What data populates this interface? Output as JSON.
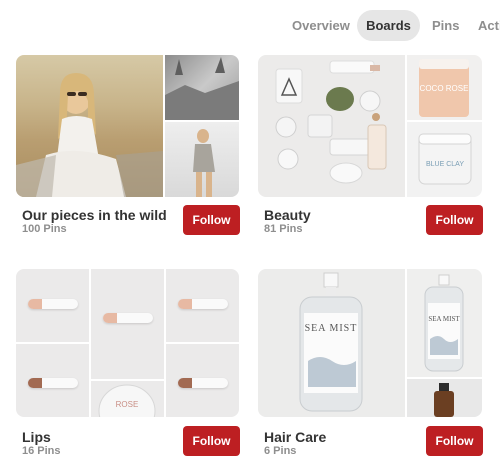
{
  "tabs": [
    {
      "label": "Overview",
      "active": false
    },
    {
      "label": "Boards",
      "active": true
    },
    {
      "label": "Pins",
      "active": false
    },
    {
      "label": "Acti",
      "active": false
    }
  ],
  "boards": [
    {
      "title": "Our pieces in the wild",
      "count": "100 Pins",
      "follow_label": "Follow"
    },
    {
      "title": "Beauty",
      "count": "81 Pins",
      "follow_label": "Follow",
      "product_text": {
        "jar_top": "COCO ROSE",
        "jar_bottom": "BLUE CLAY"
      }
    },
    {
      "title": "Lips",
      "count": "16 Pins",
      "follow_label": "Follow",
      "product_text": {
        "tin": "ROSE"
      }
    },
    {
      "title": "Hair Care",
      "count": "6 Pins",
      "follow_label": "Follow",
      "product_text": {
        "main_bottle": "SEA MIST",
        "side_bottle": "SEA MIST"
      }
    }
  ],
  "colors": {
    "follow_button": "#bd1f22",
    "active_tab_bg": "#e6e6e6",
    "muted_text": "#8e8e8e"
  }
}
